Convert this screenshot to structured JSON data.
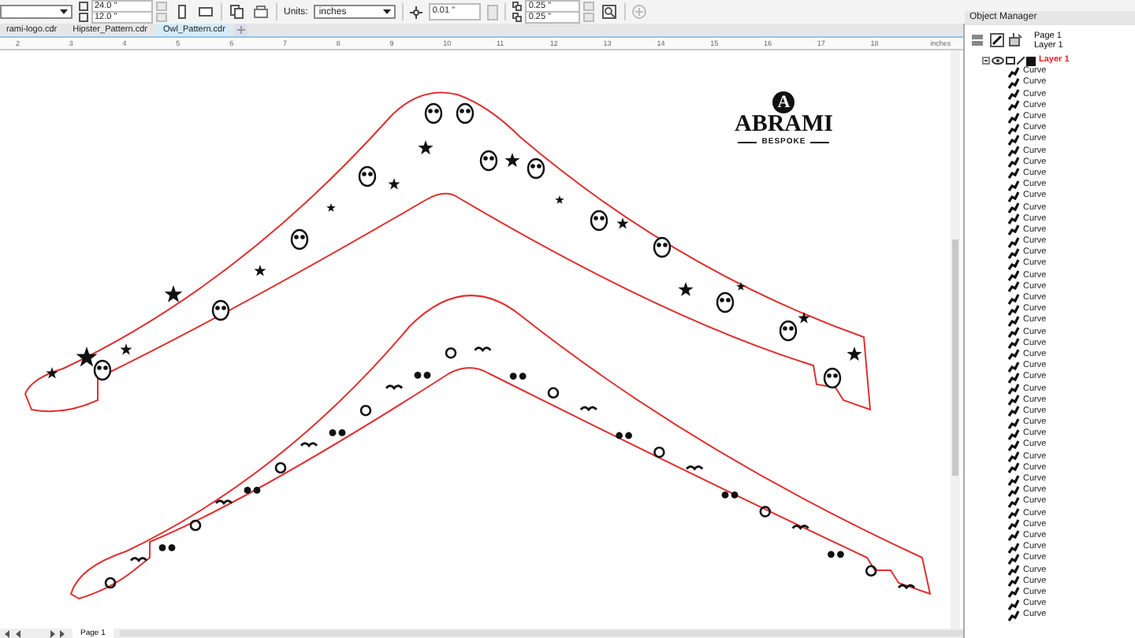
{
  "toolbar": {
    "page_width": "24.0 \"",
    "page_height": "12.0 \"",
    "units_label": "Units:",
    "units": "inches",
    "nudge": "0.01 \"",
    "duplicate_x": "0.25 \"",
    "duplicate_y": "0.25 \""
  },
  "tabs": [
    {
      "label": "rami-logo.cdr",
      "selected": false
    },
    {
      "label": "Hipster_Pattern.cdr",
      "selected": false
    },
    {
      "label": "Owl_Pattern.cdr",
      "selected": true
    }
  ],
  "ruler": {
    "labels": [
      "2",
      "3",
      "4",
      "5",
      "6",
      "7",
      "8",
      "9",
      "10",
      "11",
      "12",
      "13",
      "14",
      "15",
      "16",
      "17",
      "18"
    ],
    "unit": "inches"
  },
  "logo": {
    "mark": "A",
    "title": "ABRAMI",
    "subtitle": "BESPOKE"
  },
  "object_manager": {
    "title": "Object Manager",
    "page": "Page 1",
    "layer": "Layer 1",
    "tree": [
      {
        "label": "Layer 1",
        "expanded": true,
        "children": [
          {
            "label": "Curve"
          },
          {
            "label": "Curve"
          },
          {
            "label": "Curve"
          },
          {
            "label": "Curve"
          },
          {
            "label": "Curve"
          },
          {
            "label": "Curve"
          },
          {
            "label": "Curve"
          },
          {
            "label": "Curve"
          },
          {
            "label": "Curve"
          },
          {
            "label": "Curve"
          },
          {
            "label": "Curve"
          },
          {
            "label": "Curve"
          },
          {
            "label": "Curve"
          },
          {
            "label": "Curve"
          },
          {
            "label": "Curve"
          },
          {
            "label": "Curve"
          },
          {
            "label": "Curve"
          },
          {
            "label": "Curve"
          },
          {
            "label": "Curve"
          },
          {
            "label": "Curve"
          },
          {
            "label": "Curve"
          },
          {
            "label": "Curve"
          },
          {
            "label": "Curve"
          },
          {
            "label": "Curve"
          },
          {
            "label": "Curve"
          },
          {
            "label": "Curve"
          },
          {
            "label": "Curve"
          },
          {
            "label": "Curve"
          },
          {
            "label": "Curve"
          },
          {
            "label": "Curve"
          },
          {
            "label": "Curve"
          },
          {
            "label": "Curve"
          },
          {
            "label": "Curve"
          },
          {
            "label": "Curve"
          },
          {
            "label": "Curve"
          },
          {
            "label": "Curve"
          },
          {
            "label": "Curve"
          },
          {
            "label": "Curve"
          },
          {
            "label": "Curve"
          },
          {
            "label": "Curve"
          },
          {
            "label": "Curve"
          },
          {
            "label": "Curve"
          },
          {
            "label": "Curve"
          },
          {
            "label": "Curve"
          },
          {
            "label": "Curve"
          },
          {
            "label": "Curve"
          },
          {
            "label": "Curve"
          },
          {
            "label": "Curve"
          },
          {
            "label": "Curve"
          }
        ]
      }
    ]
  },
  "page_tabs": [
    {
      "label": "Page 1"
    }
  ]
}
